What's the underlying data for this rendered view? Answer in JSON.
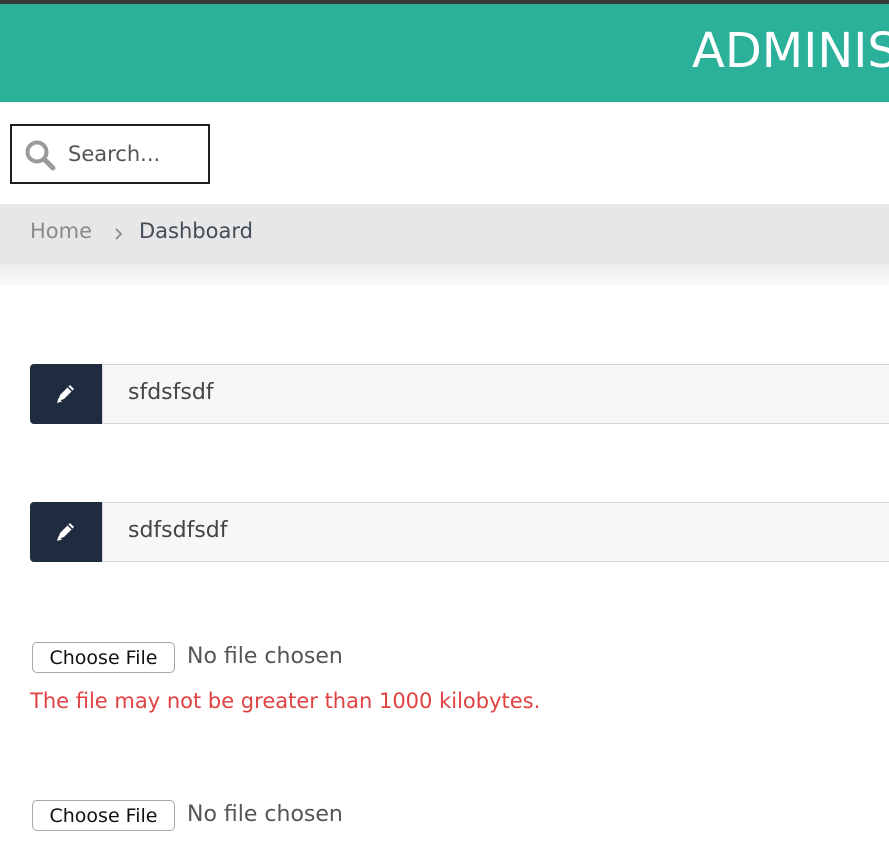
{
  "header": {
    "title": "ADMINIS",
    "background_color": "#2bb09a"
  },
  "search": {
    "placeholder": "Search...",
    "icon": "search-icon"
  },
  "breadcrumb": {
    "items": [
      {
        "label": "Home"
      },
      {
        "label": "Dashboard"
      }
    ],
    "separator_icon": "chevron-right-icon"
  },
  "form": {
    "text_fields": [
      {
        "icon": "pencil-icon",
        "value": "sfdsfsdf"
      },
      {
        "icon": "pencil-icon",
        "value": "sdfsdfsdf"
      }
    ],
    "file_inputs": [
      {
        "button_label": "Choose File",
        "status": "No file chosen",
        "error": "The file may not be greater than 1000 kilobytes."
      },
      {
        "button_label": "Choose File",
        "status": "No file chosen"
      }
    ]
  },
  "colors": {
    "accent": "#2bb09a",
    "addon": "#1f2b3e",
    "error": "#e04141"
  }
}
